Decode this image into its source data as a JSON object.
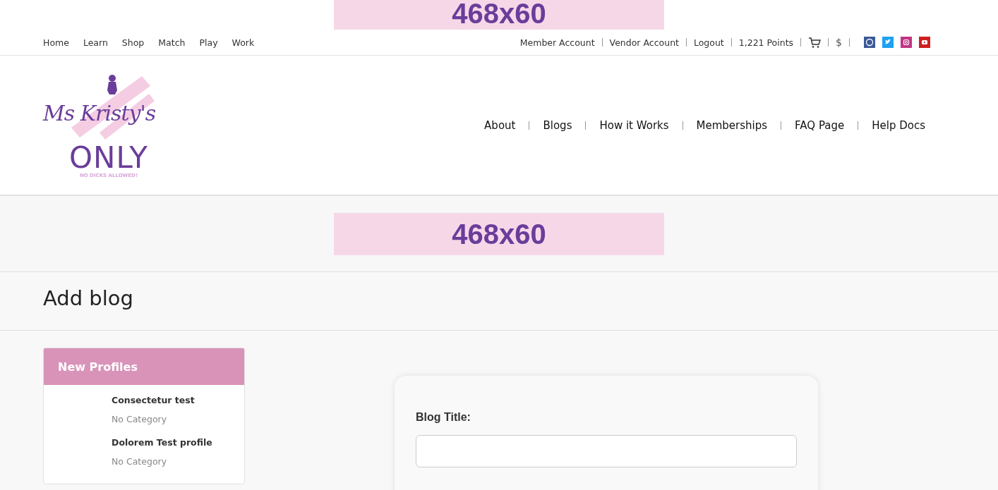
{
  "top_ad": {
    "text": "468x60"
  },
  "top_nav": [
    "Home",
    "Learn",
    "Shop",
    "Match",
    "Play",
    "Work"
  ],
  "account_links": [
    "Member Account",
    "Vendor Account",
    "Logout",
    "1,221 Points"
  ],
  "currency": "$",
  "social": [
    {
      "kind": "facebook",
      "color": "#3b5998"
    },
    {
      "kind": "twitter",
      "color": "#1da1f2"
    },
    {
      "kind": "instagram",
      "color": "#c13584"
    },
    {
      "kind": "youtube",
      "color": "#cd201f"
    }
  ],
  "logo": {
    "script": "Ms Kristy's",
    "word": "ONLY",
    "tagline": "NO DICKS ALLOWED!"
  },
  "main_nav": [
    "About",
    "Blogs",
    "How it Works",
    "Memberships",
    "FAQ Page",
    "Help Docs"
  ],
  "ad": {
    "text": "468x60"
  },
  "page_title": "Add blog",
  "profiles": {
    "title": "New Profiles",
    "items": [
      {
        "name": "Consectetur test",
        "category": "No Category"
      },
      {
        "name": "Dolorem Test profile",
        "category": "No Category"
      }
    ]
  },
  "form": {
    "field_label": "Blog Title:"
  }
}
